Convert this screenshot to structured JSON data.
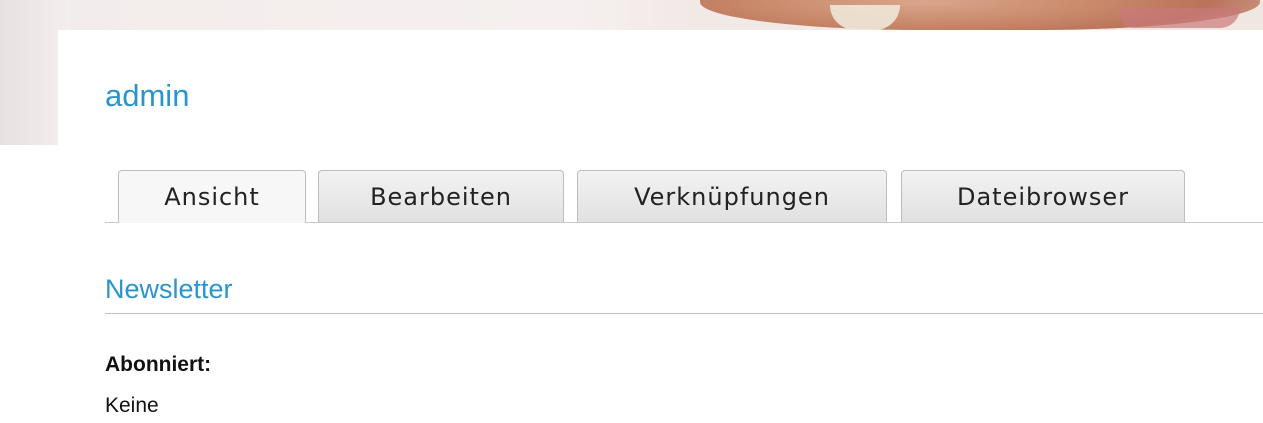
{
  "user": {
    "name": "admin"
  },
  "tabs": [
    {
      "label": "Ansicht",
      "active": true
    },
    {
      "label": "Bearbeiten",
      "active": false
    },
    {
      "label": "Verknüpfungen",
      "active": false
    },
    {
      "label": "Dateibrowser",
      "active": false
    }
  ],
  "newsletter": {
    "heading": "Newsletter",
    "field_label": "Abonniert:",
    "field_value": "Keine"
  },
  "colors": {
    "accent": "#2a95c9",
    "tab_background": "#e6e6e6",
    "text": "#111111"
  }
}
